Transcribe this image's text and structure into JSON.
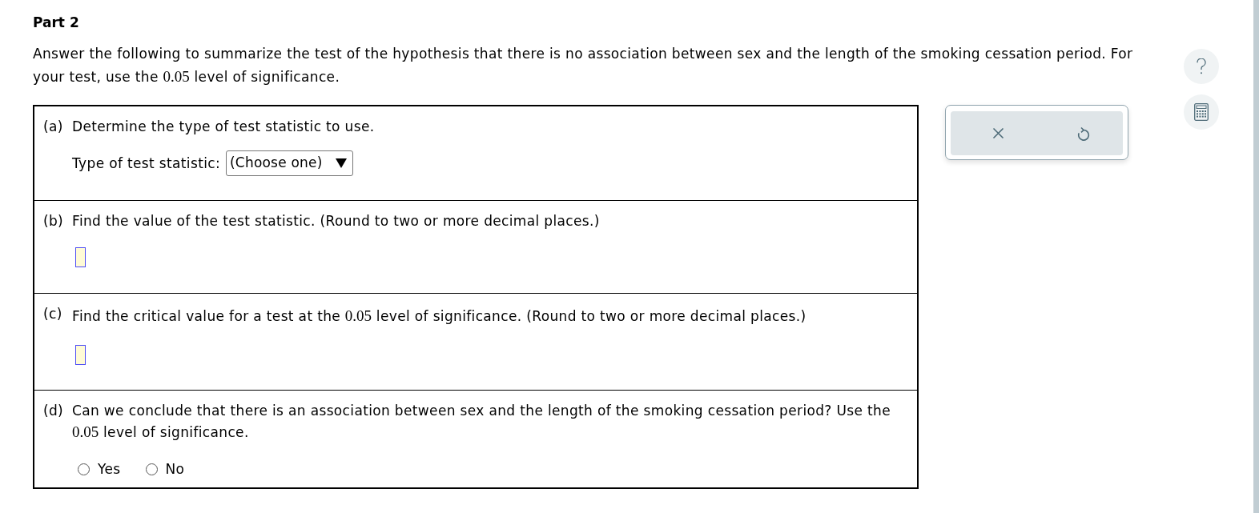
{
  "part_title": "Part 2",
  "instructions": [
    {
      "kind": "text",
      "text": "Answer the following to summarize the test of the hypothesis that there is no association between sex and the length of the smoking cessation period. For your test, use the "
    },
    {
      "kind": "math",
      "text": "0.05"
    },
    {
      "kind": "text",
      "text": " level of significance."
    }
  ],
  "questions": [
    {
      "label": "(a)",
      "kind": "dropdown",
      "prompt": [
        {
          "kind": "text",
          "text": "Determine the type of test statistic to use."
        }
      ],
      "field_label": "Type of test statistic:",
      "dropdown": {
        "value": "(Choose one)"
      }
    },
    {
      "label": "(b)",
      "kind": "answer_box",
      "prompt": [
        {
          "kind": "text",
          "text": "Find the value of the test statistic. (Round to two or more decimal places.)"
        }
      ]
    },
    {
      "label": "(c)",
      "kind": "answer_box",
      "prompt": [
        {
          "kind": "text",
          "text": "Find the critical value for a test at the "
        },
        {
          "kind": "math",
          "text": "0.05"
        },
        {
          "kind": "text",
          "text": " level of significance. (Round to two or more decimal places.)"
        }
      ]
    },
    {
      "label": "(d)",
      "kind": "radio",
      "prompt": [
        {
          "kind": "text",
          "text": "Can we conclude that there is an association between sex and the length of the smoking cessation period? Use the "
        },
        {
          "kind": "math",
          "text": "0.05"
        },
        {
          "kind": "text",
          "text": " level of significance."
        }
      ],
      "options": [
        {
          "label": "Yes",
          "selected": false
        },
        {
          "label": "No",
          "selected": false
        }
      ]
    }
  ]
}
